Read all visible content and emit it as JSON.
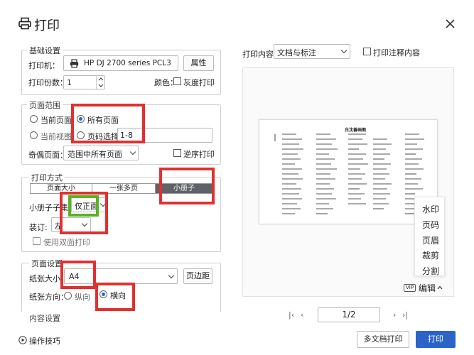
{
  "window": {
    "title": "打印"
  },
  "basic": {
    "legend": "基础设置",
    "printer_label": "打印机：",
    "printer_value": "HP DJ 2700 series PCL3",
    "properties_btn": "属性",
    "copies_label": "打印份数：",
    "copies_value": "1",
    "color_label": "颜色：",
    "grayscale_label": "灰度打印"
  },
  "range": {
    "legend": "页面范围",
    "current_page": "当前页面",
    "all_pages": "所有页面",
    "current_view": "当前视图",
    "page_select": "页码选择：",
    "page_select_value": "1-8",
    "odd_even_label": "奇偶页面：",
    "odd_even_value": "范围中所有页面",
    "reverse_label": "逆序打印"
  },
  "mode": {
    "legend": "打印方式",
    "segments": [
      "页面大小",
      "一张多页",
      "小册子"
    ],
    "booklet_set_label": "小册子子集:",
    "booklet_set_value": "仅正面",
    "binding_label": "装订:",
    "binding_value": "左",
    "duplex_label": "使用双面打印"
  },
  "page_setup": {
    "legend": "页面设置",
    "paper_size_label": "纸张大小",
    "paper_size_value": "A4",
    "margins_btn": "页边距",
    "orientation_label": "纸张方向：",
    "portrait": "纵向",
    "landscape": "横向",
    "content_settings": "内容设置"
  },
  "footer": {
    "tips": "操作技巧",
    "multi_doc_btn": "多文档打印",
    "print_btn": "打印"
  },
  "preview": {
    "content_label": "打印内容：",
    "content_value": "文档与标注",
    "annot_label": "打印注释内容",
    "doc_title": "白沈善画图",
    "page_indicator": "1/2",
    "side_menu": [
      "水印",
      "页码",
      "页眉",
      "裁剪",
      "分割"
    ],
    "vip_badge": "VIP",
    "edit_label": "编辑"
  },
  "colors": {
    "accent": "#2b63c8",
    "annotation_red": "#e03131",
    "annotation_green": "#57b320",
    "segment_active": "#5f6368"
  }
}
